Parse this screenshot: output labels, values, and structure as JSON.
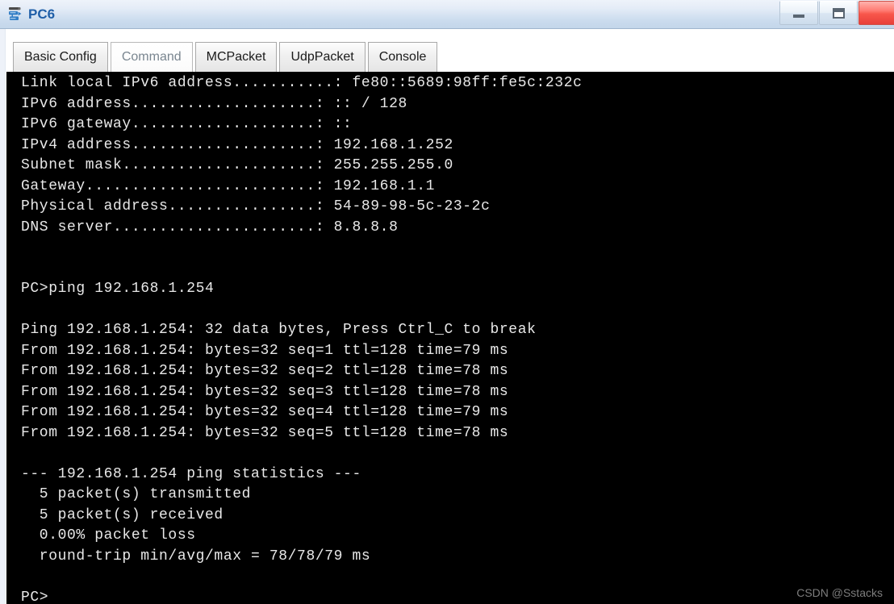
{
  "window": {
    "title": "PC6",
    "icon": "pc-device-icon",
    "controls": [
      {
        "name": "minimize-button",
        "glyph": "minimize-icon",
        "label": "Minimize"
      },
      {
        "name": "maximize-button",
        "glyph": "maximize-icon",
        "label": "Maximize"
      },
      {
        "name": "close-button",
        "glyph": "close-icon",
        "label": "Close"
      }
    ]
  },
  "tabs": [
    {
      "label": "Basic Config",
      "active": false
    },
    {
      "label": "Command",
      "active": true
    },
    {
      "label": "MCPacket",
      "active": false
    },
    {
      "label": "UdpPacket",
      "active": false
    },
    {
      "label": "Console",
      "active": false
    }
  ],
  "console": {
    "background_color": "#000000",
    "text_color": "#e8e8e8",
    "lines": [
      "Link local IPv6 address...........: fe80::5689:98ff:fe5c:232c",
      "IPv6 address....................: :: / 128",
      "IPv6 gateway....................: ::",
      "IPv4 address....................: 192.168.1.252",
      "Subnet mask.....................: 255.255.255.0",
      "Gateway.........................: 192.168.1.1",
      "Physical address................: 54-89-98-5c-23-2c",
      "DNS server......................: 8.8.8.8",
      "",
      "",
      "PC>ping 192.168.1.254",
      "",
      "Ping 192.168.1.254: 32 data bytes, Press Ctrl_C to break",
      "From 192.168.1.254: bytes=32 seq=1 ttl=128 time=79 ms",
      "From 192.168.1.254: bytes=32 seq=2 ttl=128 time=78 ms",
      "From 192.168.1.254: bytes=32 seq=3 ttl=128 time=78 ms",
      "From 192.168.1.254: bytes=32 seq=4 ttl=128 time=79 ms",
      "From 192.168.1.254: bytes=32 seq=5 ttl=128 time=78 ms",
      "",
      "--- 192.168.1.254 ping statistics ---",
      "  5 packet(s) transmitted",
      "  5 packet(s) received",
      "  0.00% packet loss",
      "  round-trip min/avg/max = 78/78/79 ms",
      "",
      "PC>"
    ]
  },
  "watermark": {
    "text": "CSDN @Sstacks"
  }
}
